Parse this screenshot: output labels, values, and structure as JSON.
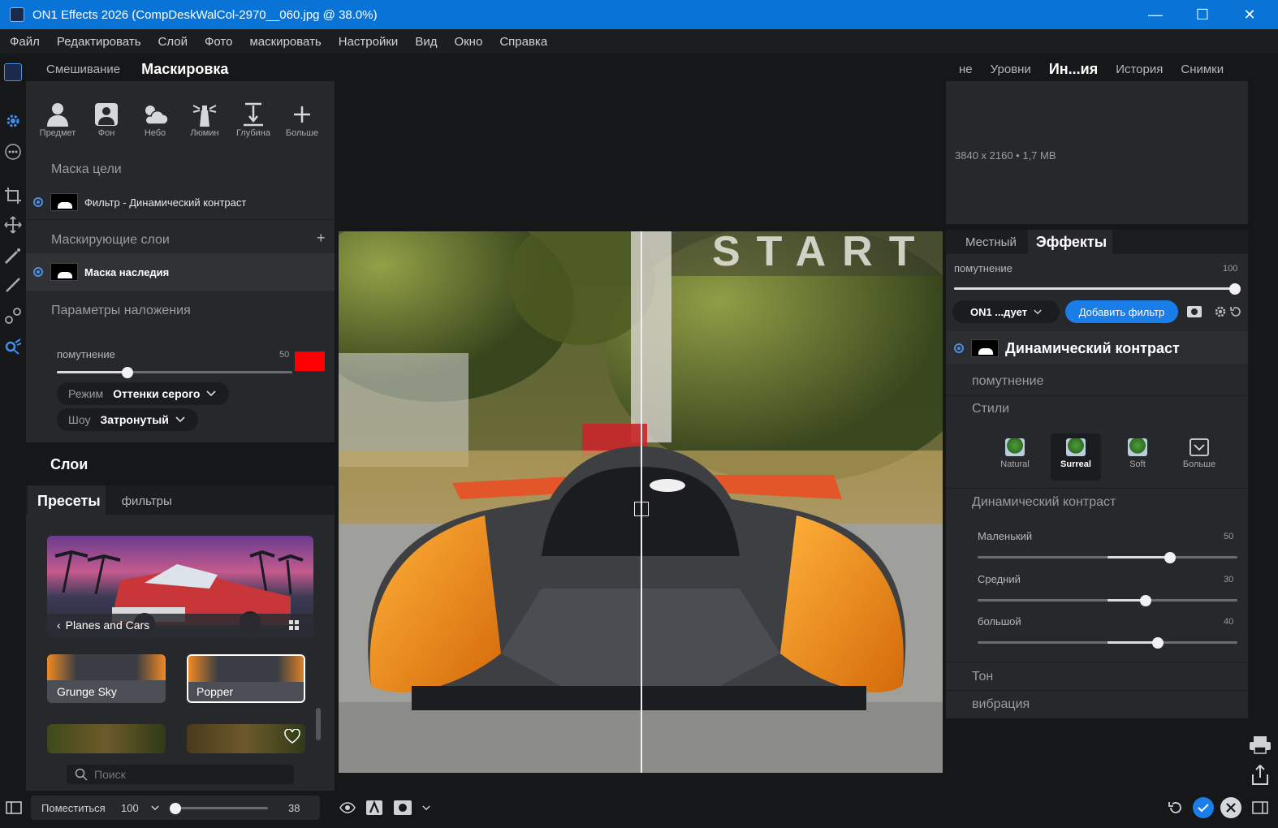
{
  "window": {
    "title": "ON1 Effects 2026 (CompDeskWalCol-2970__060.jpg @ 38.0%)",
    "minimize": "—",
    "maximize": "☐",
    "close": "✕"
  },
  "menu": [
    "Файл",
    "Редактировать",
    "Слой",
    "Фото",
    "маскировать",
    "Настройки",
    "Вид",
    "Окно",
    "Справка"
  ],
  "left": {
    "tabs": [
      "Смешивание",
      "Маскировка"
    ],
    "mask_tools": [
      {
        "label": "Предмет",
        "icon": "person-icon"
      },
      {
        "label": "Фон",
        "icon": "portrait-icon"
      },
      {
        "label": "Небо",
        "icon": "cloud-sun-icon"
      },
      {
        "label": "Люмин",
        "icon": "lighthouse-icon"
      },
      {
        "label": "Глубина",
        "icon": "depth-icon"
      },
      {
        "label": "Больше",
        "icon": "plus-icon"
      }
    ],
    "target_mask_title": "Маска цели",
    "target_mask_item": "Фильтр - Динамический контраст",
    "mask_layers_title": "Маскирующие слои",
    "mask_layers_add": "+",
    "mask_layer_item": "Маска наследия",
    "blend_params_title": "Параметры наложения",
    "opacity_label": "помутнение",
    "opacity_value": "50",
    "opacity_fraction": 0.3,
    "mask_color": "#ff0000",
    "mode_label": "Режим",
    "mode_value": "Оттенки серого",
    "show_label": "Шоу",
    "show_value": "Затронутый",
    "layers_title": "Слои",
    "preset_tabs": [
      "Пресеты",
      "фильтры"
    ],
    "preset_category": "Planes and Cars",
    "presets": [
      "Grunge Sky",
      "Popper"
    ],
    "search_placeholder": "Поиск"
  },
  "right": {
    "top_tabs": [
      "не",
      "Уровни",
      "Ин...ия",
      "История",
      "Снимки"
    ],
    "image_info": "3840 x 2160 • 1,7 MB",
    "effect_tabs": [
      "Местный",
      "Эффекты"
    ],
    "global_opacity_label": "помутнение",
    "global_opacity_value": "100",
    "global_opacity_fraction": 1.0,
    "preset_dropdown": "ON1 ...дует",
    "add_filter": "Добавить фильтр",
    "filter_name": "Динамический контраст",
    "filter_opacity": "помутнение",
    "styles_title": "Стили",
    "styles": [
      {
        "label": "Natural"
      },
      {
        "label": "Surreal",
        "selected": true
      },
      {
        "label": "Soft"
      },
      {
        "label": "Больше"
      }
    ],
    "dc_title": "Динамический контраст",
    "sliders": [
      {
        "label": "Маленький",
        "value": "50",
        "fraction": 0.74
      },
      {
        "label": "Средний",
        "value": "30",
        "fraction": 0.646
      },
      {
        "label": "большой",
        "value": "40",
        "fraction": 0.693
      }
    ],
    "tone": "Тон",
    "vibrance": "вибрация"
  },
  "canvas": {
    "sign_text": "START"
  },
  "bottom": {
    "fit_label": "Поместиться",
    "zoom_value": "100",
    "slider_value": "38",
    "zoom_fraction": 0.05
  }
}
